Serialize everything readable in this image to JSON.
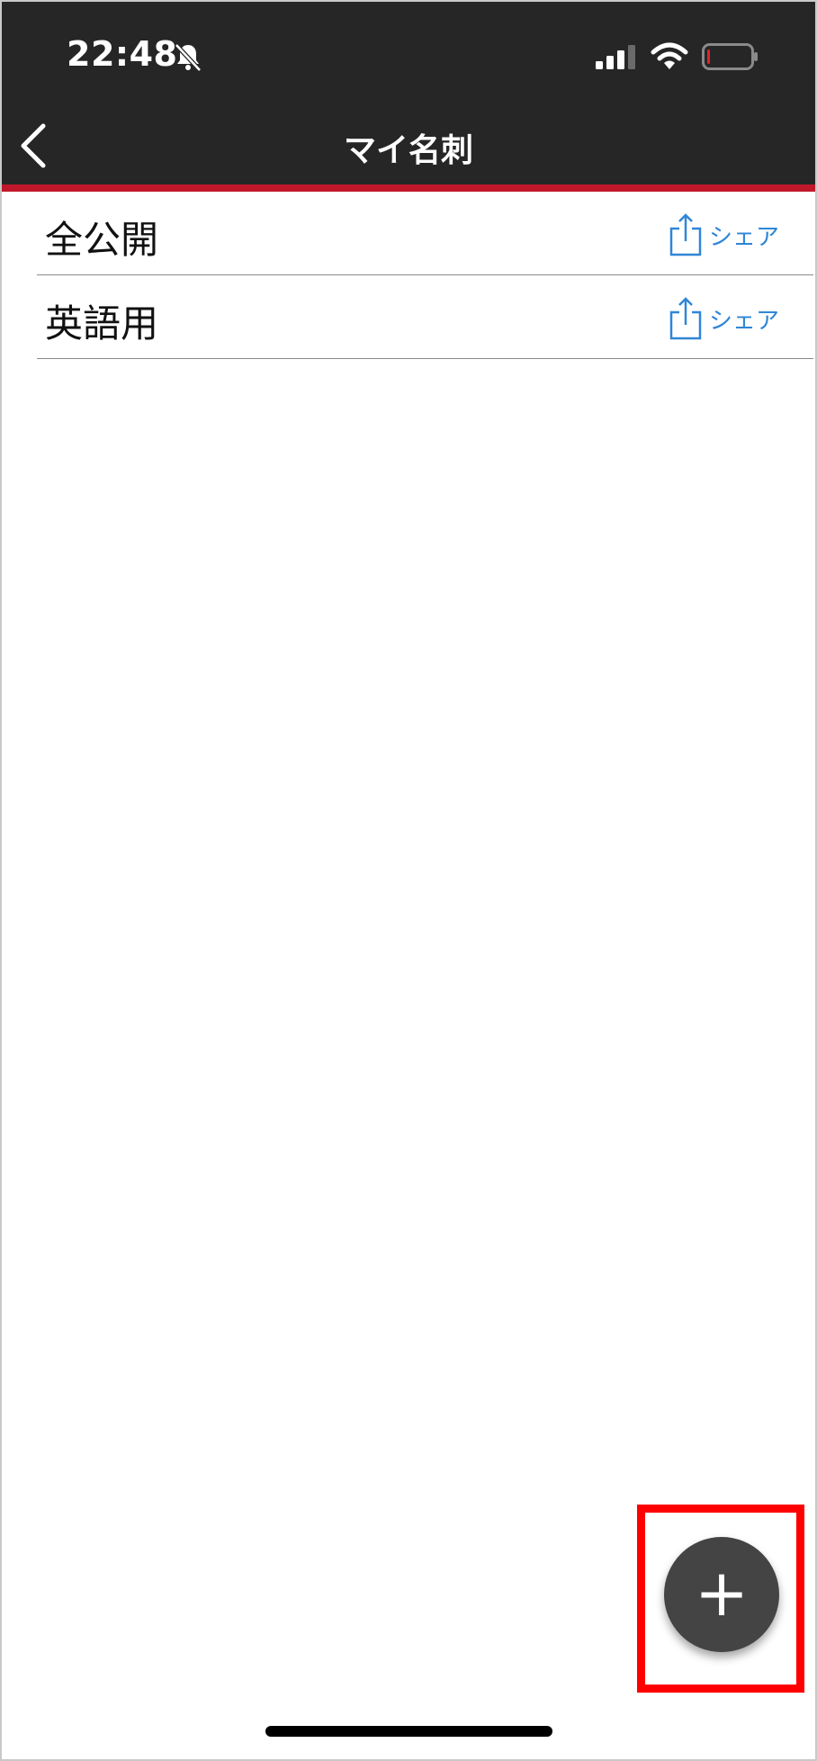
{
  "status_bar": {
    "time": "22:48",
    "icons": [
      "bell-slash-icon",
      "cellular-signal-icon",
      "wifi-icon",
      "battery-low-icon"
    ]
  },
  "header": {
    "title": "マイ名刺",
    "back_icon": "chevron-left-icon"
  },
  "cards": [
    {
      "label": "全公開",
      "share_label": "シェア"
    },
    {
      "label": "英語用",
      "share_label": "シェア"
    }
  ],
  "fab": {
    "label": "+"
  },
  "colors": {
    "header_bg": "#262626",
    "accent_red": "#c0182a",
    "share_blue": "#2f86d6",
    "fab_bg": "#444444",
    "highlight": "#ff0000"
  }
}
